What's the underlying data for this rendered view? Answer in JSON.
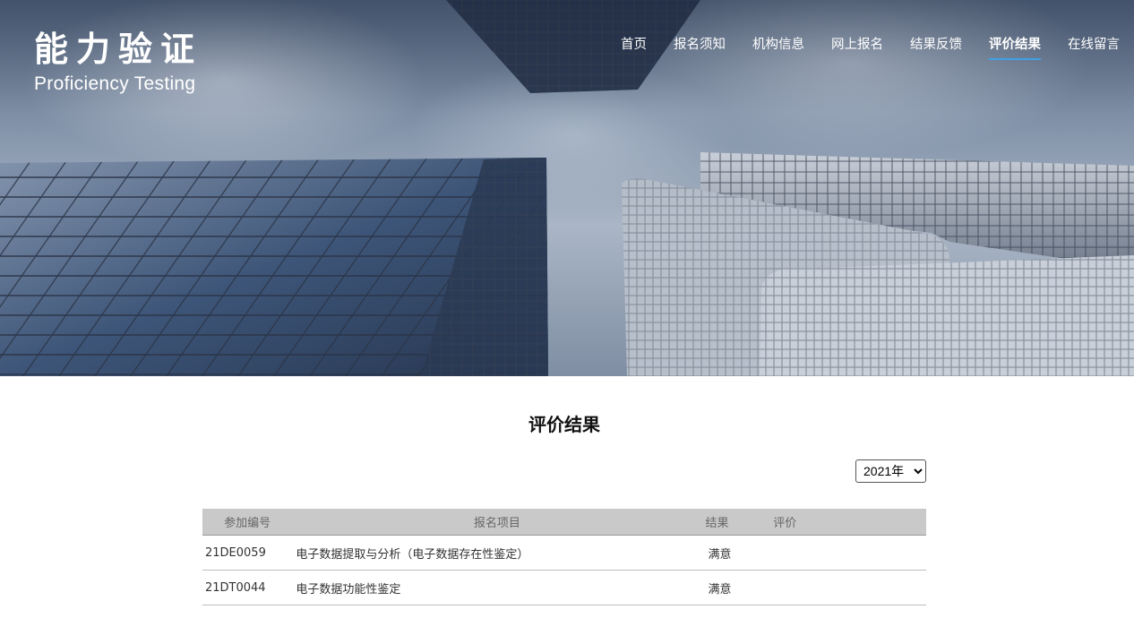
{
  "brand": {
    "title_cn": "能力验证",
    "title_en": "Proficiency Testing"
  },
  "nav": {
    "items": [
      {
        "label": "首页"
      },
      {
        "label": "报名须知"
      },
      {
        "label": "机构信息"
      },
      {
        "label": "网上报名"
      },
      {
        "label": "结果反馈"
      },
      {
        "label": "评价结果",
        "active": true
      },
      {
        "label": "在线留言"
      }
    ],
    "active_underline_color": "#3fa0e6"
  },
  "page": {
    "title": "评价结果"
  },
  "year_filter": {
    "selected": "2021年"
  },
  "table": {
    "headers": {
      "id": "参加编号",
      "project": "报名项目",
      "result": "结果",
      "evaluation": "评价"
    },
    "rows": [
      {
        "id": "21DE0059",
        "project": "电子数据提取与分析（电子数据存在性鉴定）",
        "result": "满意",
        "evaluation": ""
      },
      {
        "id": "21DT0044",
        "project": "电子数据功能性鉴定",
        "result": "满意",
        "evaluation": ""
      }
    ]
  }
}
